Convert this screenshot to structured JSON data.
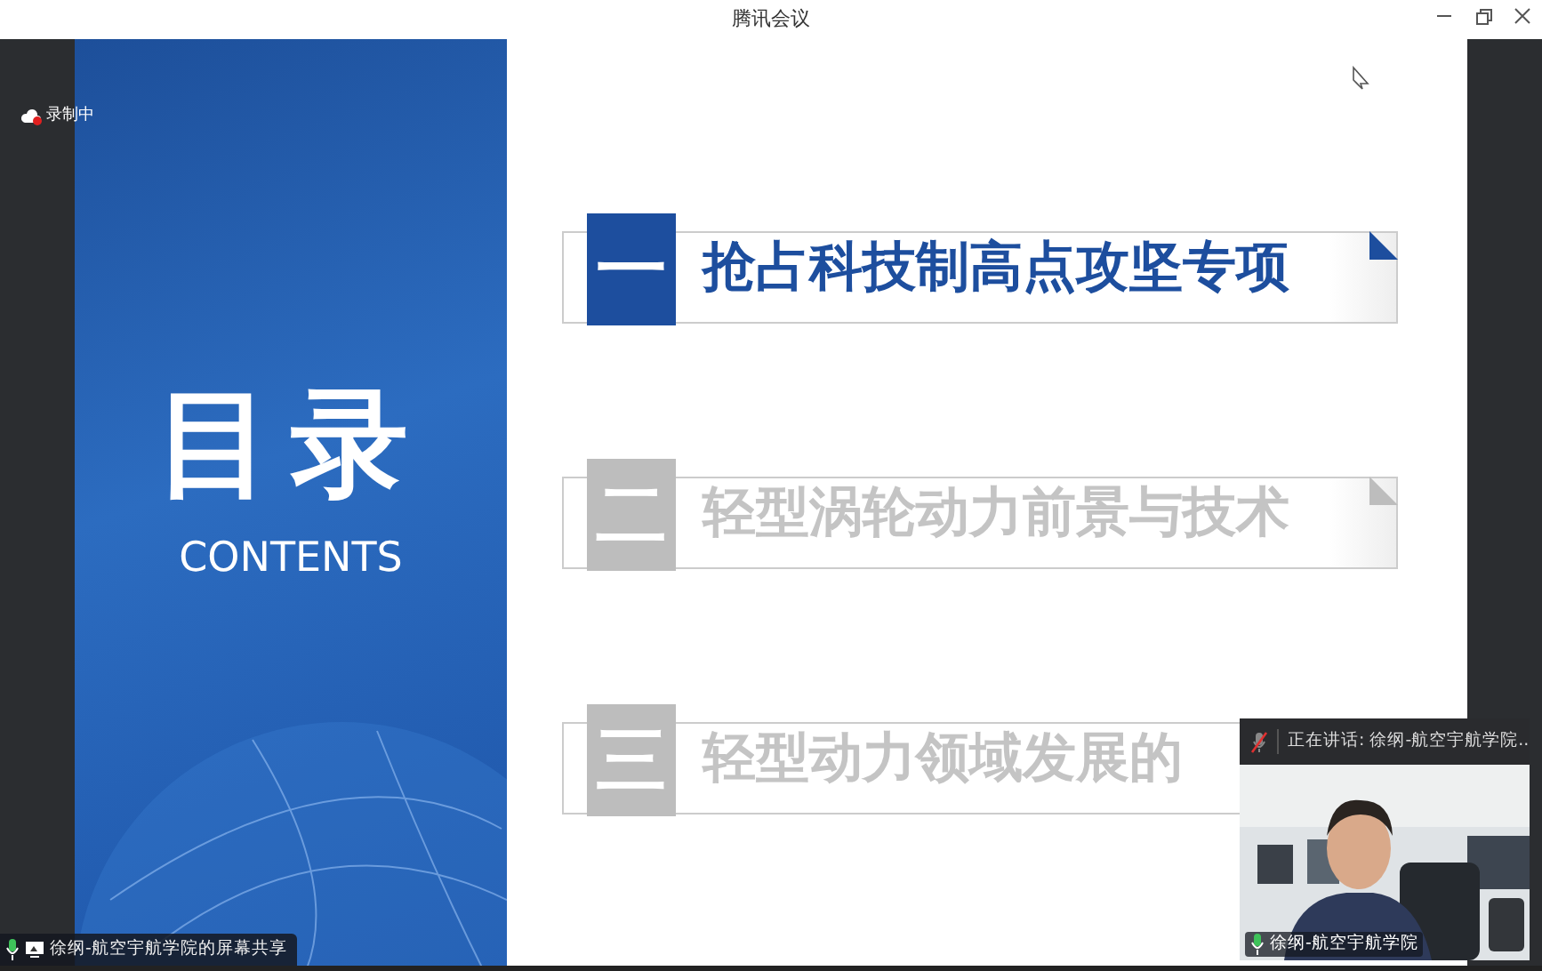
{
  "window": {
    "title": "腾讯会议"
  },
  "recording": {
    "label": "录制中"
  },
  "slide": {
    "title": "目录",
    "subtitle": "CONTENTS",
    "items": [
      {
        "number": "一",
        "label": "抢占科技制高点攻坚专项",
        "selected": true,
        "corner_fold": true
      },
      {
        "number": "二",
        "label": "轻型涡轮动力前景与技术",
        "selected": false,
        "corner_fold": true
      },
      {
        "number": "三",
        "label": "轻型动力领域发展的",
        "selected": false,
        "corner_fold": false
      }
    ]
  },
  "video_tile": {
    "speaking": "正在讲话:  徐纲-航空宇航学院..",
    "name": "徐纲-航空宇航学院",
    "muted": true
  },
  "share_label": {
    "text": "徐纲-航空宇航学院的屏幕共享"
  }
}
